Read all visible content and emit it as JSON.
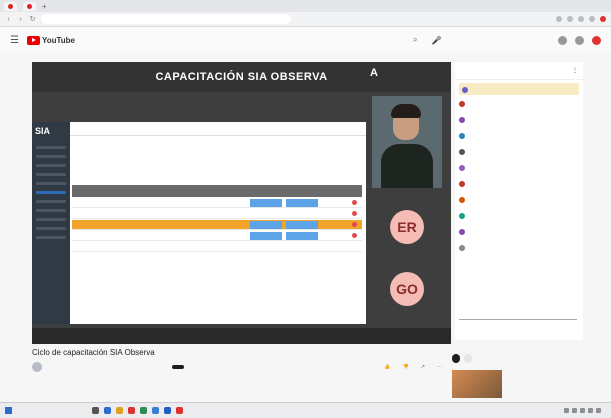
{
  "video": {
    "title_overlay": "CAPACITACIÓN SIA OBSERVA",
    "shared_brand": "SIA",
    "participants": [
      {
        "initials": "ER",
        "avatar_color": "#f4bcb5"
      },
      {
        "initials": "GO",
        "avatar_color": "#f4bcb5"
      }
    ]
  },
  "page": {
    "video_title": "Ciclo de capacitación SIA Observa"
  },
  "colors": {
    "youtube_red": "#e00000",
    "highlight_row": "#f1a32b",
    "cell_blue": "#5da3e8",
    "video_bg": "#3e3e3e"
  },
  "icons": [
    "menu-icon",
    "search-icon",
    "mic-icon",
    "notifications-icon",
    "windows-icon"
  ]
}
